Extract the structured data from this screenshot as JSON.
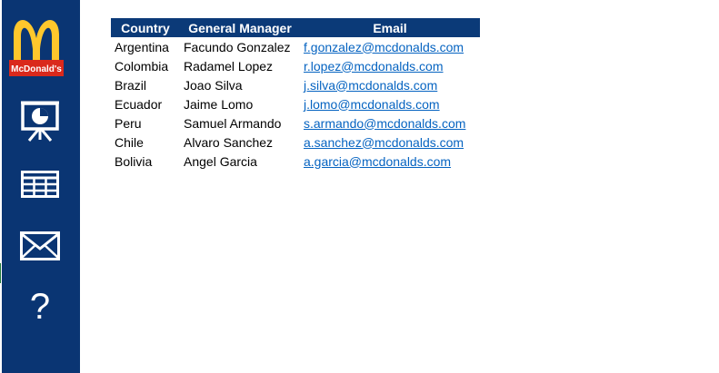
{
  "sidebar": {
    "logo_text": "McDonald's",
    "brand_colors": {
      "arches": "#ffc72c",
      "banner": "#da291c",
      "sidebar": "#0a3573"
    },
    "items": [
      {
        "icon": "presentation-chart-icon"
      },
      {
        "icon": "table-grid-icon"
      },
      {
        "icon": "envelope-icon"
      },
      {
        "icon": "help-icon",
        "glyph": "?"
      }
    ]
  },
  "table": {
    "header_color": "#0b3a78",
    "link_color": "#0563c1",
    "columns": [
      "Country",
      "General Manager",
      "Email"
    ],
    "rows": [
      {
        "country": "Argentina",
        "manager": "Facundo Gonzalez",
        "email": "f.gonzalez@mcdonalds.com"
      },
      {
        "country": "Colombia",
        "manager": "Radamel Lopez",
        "email": "r.lopez@mcdonalds.com"
      },
      {
        "country": "Brazil",
        "manager": "Joao Silva",
        "email": "j.silva@mcdonalds.com"
      },
      {
        "country": "Ecuador",
        "manager": "Jaime Lomo",
        "email": "j.lomo@mcdonalds.com"
      },
      {
        "country": "Peru",
        "manager": "Samuel Armando",
        "email": "s.armando@mcdonalds.com"
      },
      {
        "country": "Chile",
        "manager": "Alvaro Sanchez",
        "email": "a.sanchez@mcdonalds.com"
      },
      {
        "country": "Bolivia",
        "manager": "Angel Garcia",
        "email": "a.garcia@mcdonalds.com"
      }
    ]
  }
}
